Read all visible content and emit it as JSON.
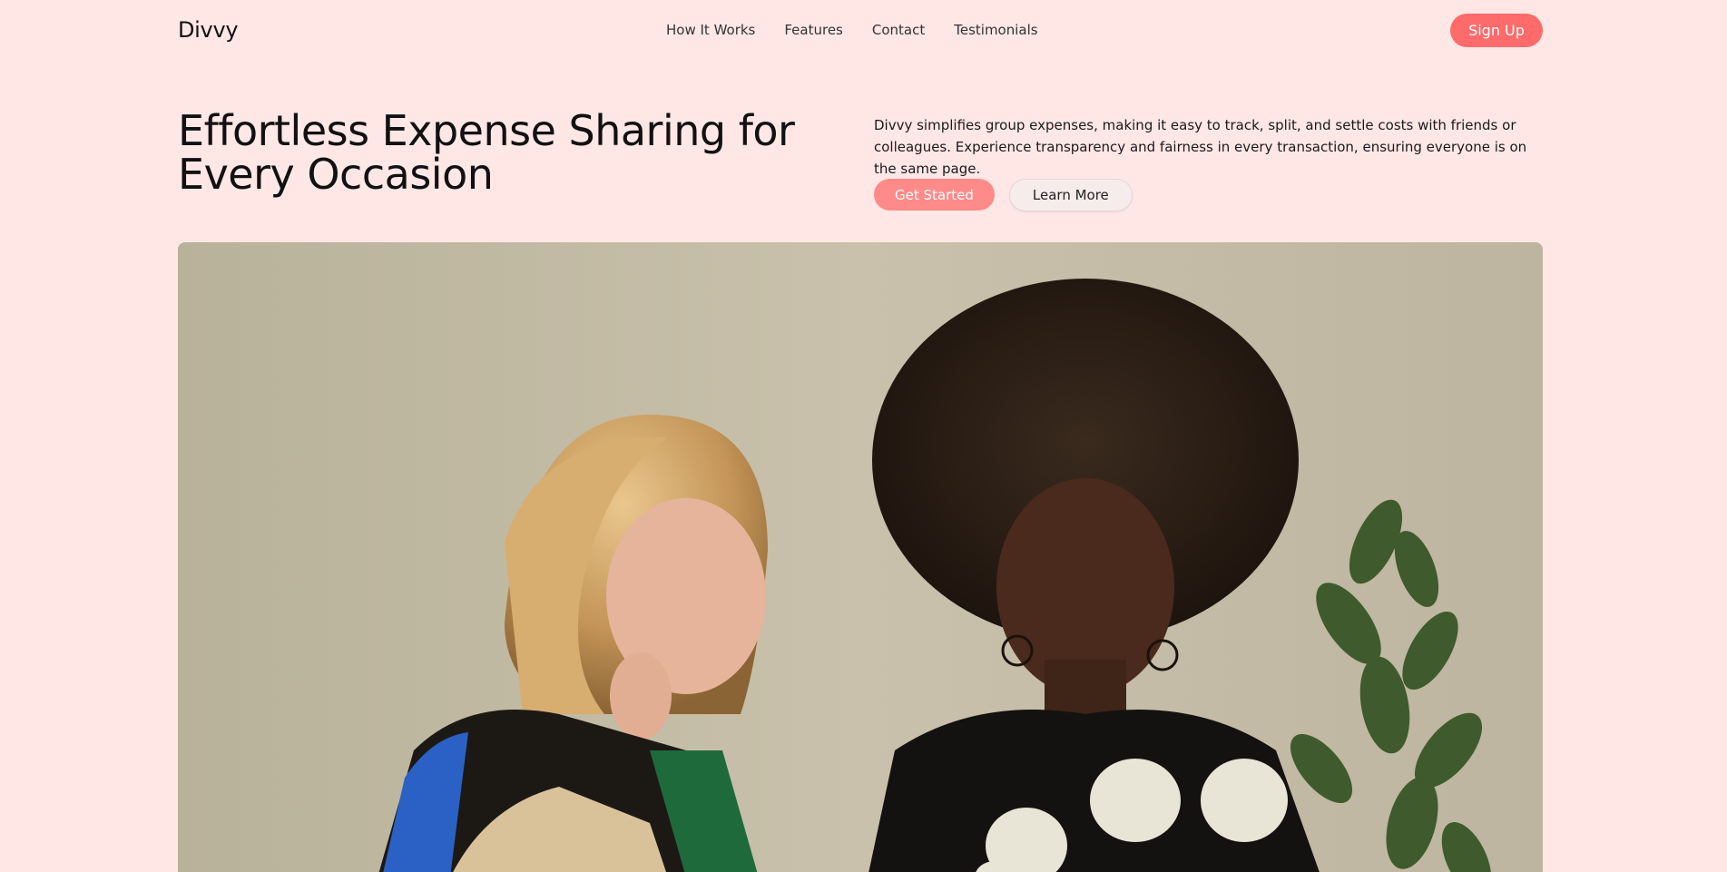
{
  "header": {
    "logo": "Divvy",
    "nav": [
      "How It Works",
      "Features",
      "Contact",
      "Testimonials"
    ],
    "signup_label": "Sign Up"
  },
  "hero": {
    "title": "Effortless Expense Sharing for Every Occasion",
    "description": "Divvy simplifies group expenses, making it easy to track, split, and settle costs with friends or colleagues. Experience transparency and fairness in every transaction, ensuring everyone is on the same page.",
    "primary_cta": "Get Started",
    "secondary_cta": "Learn More"
  },
  "colors": {
    "background": "#ffe7e6",
    "accent": "#ff6b6b",
    "primary_button": "#ff8a8a"
  }
}
